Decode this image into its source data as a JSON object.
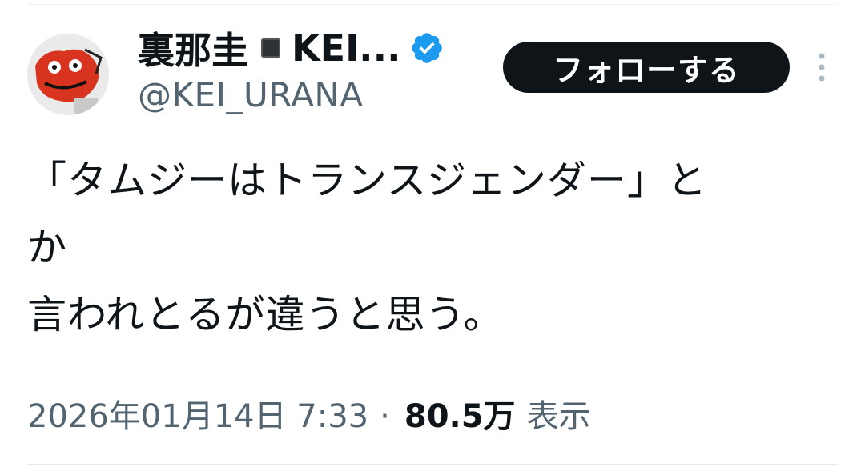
{
  "author": {
    "display_name": "裏那圭",
    "display_name_rest": "KEI...",
    "handle": "@KEI_URANA",
    "verified": true,
    "verified_color": "#1d9bf0"
  },
  "follow_button": {
    "label": "フォローする"
  },
  "tweet": {
    "lines": [
      "「タムジーはトランスジェンダー」と",
      "か",
      "言われとるが違うと思う。"
    ]
  },
  "meta": {
    "timestamp": "2026年01月14日 7:33",
    "separator": "·",
    "views_count": "80.5万",
    "views_label": "表示"
  },
  "icons": {
    "verified": "verified-badge-icon",
    "more": "more-vertical-icon"
  }
}
